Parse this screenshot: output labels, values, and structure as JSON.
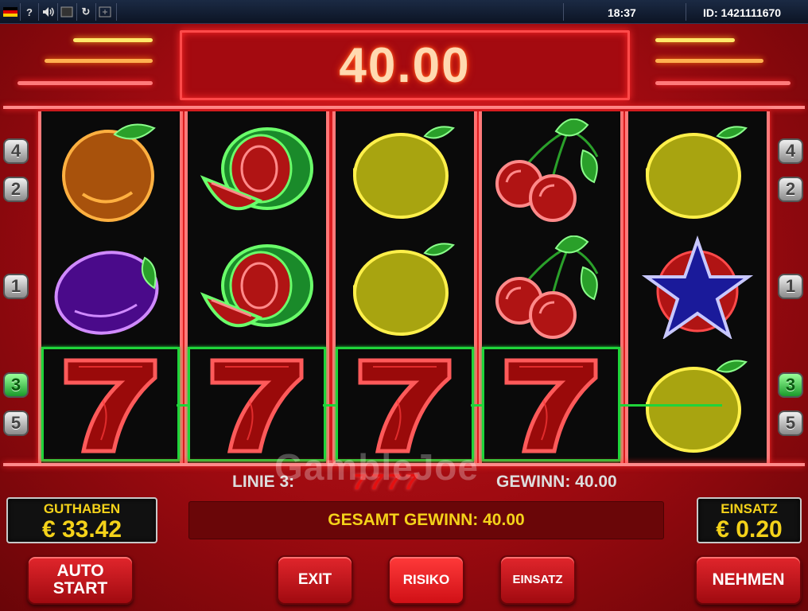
{
  "topbar": {
    "clock": "18:37",
    "session_id": "ID: 1421111670",
    "buttons": [
      {
        "icon": "german-flag-icon"
      },
      {
        "icon": "help-icon",
        "glyph": "?"
      },
      {
        "icon": "sound-icon",
        "glyph": "🔊"
      },
      {
        "icon": "stop-icon",
        "glyph": "■"
      },
      {
        "icon": "reload-icon",
        "glyph": "↻"
      },
      {
        "icon": "fullscreen-icon",
        "glyph": "⧉"
      }
    ]
  },
  "header": {
    "win_amount": "40.00"
  },
  "reels": [
    [
      "orange",
      "plum",
      "seven"
    ],
    [
      "melon",
      "melon",
      "seven"
    ],
    [
      "lemon",
      "lemon",
      "seven"
    ],
    [
      "cherry",
      "cherry",
      "seven"
    ],
    [
      "lemon",
      "star",
      "lemon"
    ]
  ],
  "winning_line": 3,
  "line_badges_left": [
    "4",
    "2",
    "1",
    "3",
    "5"
  ],
  "line_badges_right": [
    "4",
    "2",
    "1",
    "3",
    "5"
  ],
  "info": {
    "line_label": "LINIE 3:",
    "line_symbols": "7777",
    "gewinn": "GEWINN: 40.00",
    "watermark": "GambleJoe"
  },
  "balance": {
    "label": "GUTHABEN",
    "value": "€ 33.42"
  },
  "stake": {
    "label": "EINSATZ",
    "value": "€ 0.20"
  },
  "total_win": "GESAMT GEWINN: 40.00",
  "buttons": {
    "auto_start": "AUTO START",
    "exit": "EXIT",
    "risiko": "RISIKO",
    "einsatz": "EINSATZ",
    "nehmen": "NEHMEN"
  },
  "colors": {
    "cabinet_red": "#c4141a",
    "win_frame_green": "#1fd43a",
    "label_yellow": "#f4d21a"
  }
}
